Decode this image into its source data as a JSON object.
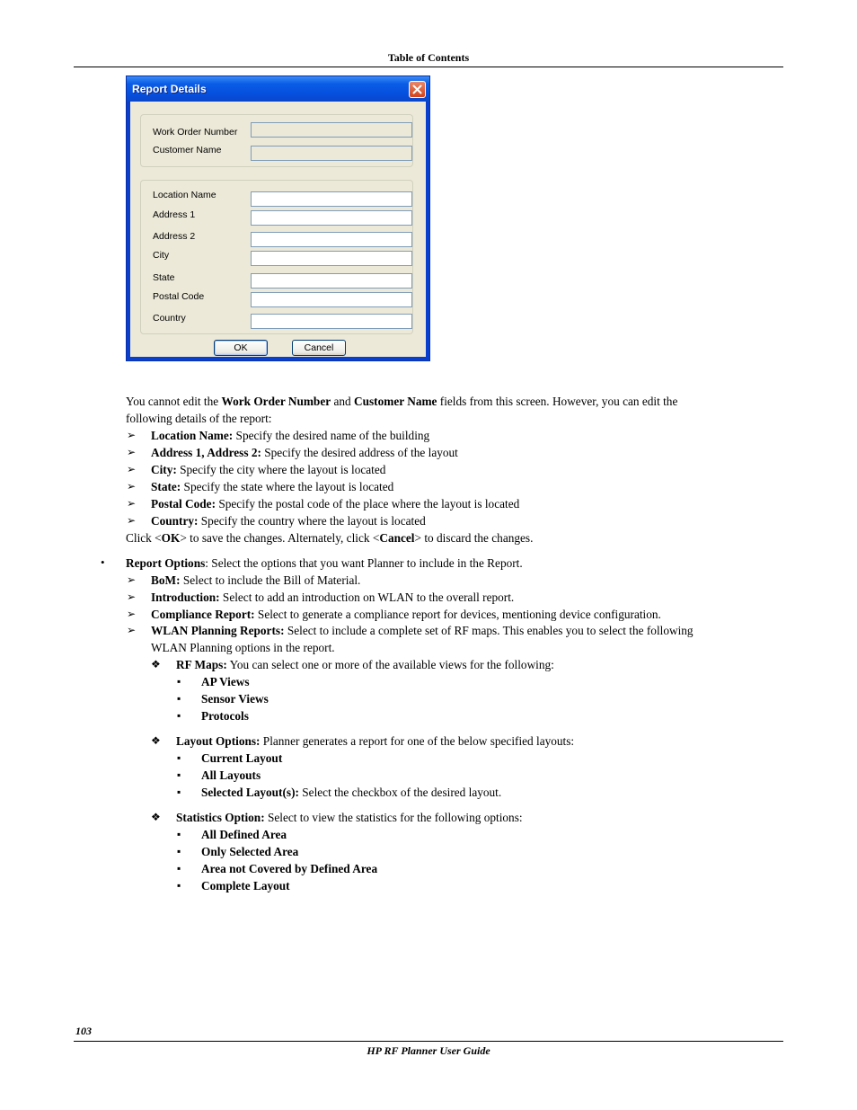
{
  "header": {
    "title": "Table of Contents"
  },
  "dialog": {
    "title": "Report Details",
    "close_icon": "close-icon",
    "group1": [
      {
        "label": "Work Order Number",
        "value": "",
        "readonly": true
      },
      {
        "label": "Customer Name",
        "value": "",
        "readonly": true
      }
    ],
    "group2": [
      {
        "label": "Location Name",
        "value": ""
      },
      {
        "label": "Address 1",
        "value": ""
      },
      {
        "label": "Address 2",
        "value": ""
      },
      {
        "label": "City",
        "value": ""
      },
      {
        "label": "State",
        "value": ""
      },
      {
        "label": "Postal Code",
        "value": ""
      },
      {
        "label": "Country",
        "value": ""
      }
    ],
    "ok_label": "OK",
    "cancel_label": "Cancel"
  },
  "body": {
    "intro": {
      "t1": "You cannot edit the ",
      "b1": "Work Order Number",
      "t2": " and ",
      "b2": "Customer Name",
      "t3": " fields from this screen. However, you can edit the",
      "line2": "following details of the report:"
    },
    "details": [
      {
        "term": "Location Name:",
        "desc": " Specify the desired name of the building"
      },
      {
        "term": "Address 1, Address 2:",
        "desc": " Specify the desired address of the layout"
      },
      {
        "term": "City:",
        "desc": " Specify the city where the layout is located"
      },
      {
        "term": "State:",
        "desc": " Specify the state where the layout is located"
      },
      {
        "term": "Postal Code:",
        "desc": " Specify the postal code of the place where the layout is located"
      },
      {
        "term": "Country:",
        "desc": " Specify the country where the layout is located"
      }
    ],
    "click_line": {
      "t1": "Click <",
      "b1": "OK",
      "t2": "> to save the changes. Alternately, click <",
      "b2": "Cancel",
      "t3": "> to discard the changes."
    },
    "report_options": {
      "term": "Report Options",
      "desc": ": Select the options that you want Planner to include in the Report.",
      "items": [
        {
          "term": "BoM:",
          "desc": " Select to include the Bill of Material."
        },
        {
          "term": "Introduction:",
          "desc": " Select to add an introduction on WLAN to the overall report."
        },
        {
          "term": "Compliance Report:",
          "desc": " Select to generate a compliance report for devices, mentioning device configuration."
        },
        {
          "term": "WLAN Planning Reports:",
          "desc": " Select to include a complete set of RF maps. This enables you to select the following",
          "desc2": "WLAN Planning options in the report."
        }
      ],
      "sub": [
        {
          "term": "RF Maps:",
          "desc": " You can select one or more of the available views for the following:",
          "items": [
            {
              "term": "AP Views",
              "desc": ""
            },
            {
              "term": "Sensor Views",
              "desc": ""
            },
            {
              "term": "Protocols",
              "desc": ""
            }
          ]
        },
        {
          "term": "Layout Options:",
          "desc": " Planner generates a report for one of the below specified layouts:",
          "items": [
            {
              "term": "Current Layout",
              "desc": ""
            },
            {
              "term": "All Layouts",
              "desc": ""
            },
            {
              "term": "Selected Layout(s):",
              "desc": " Select the checkbox of the desired layout."
            }
          ]
        },
        {
          "term": "Statistics Option:",
          "desc": " Select to view the statistics for the following options:",
          "items": [
            {
              "term": "All Defined Area",
              "desc": ""
            },
            {
              "term": "Only Selected Area",
              "desc": ""
            },
            {
              "term": "Area not Covered by Defined Area",
              "desc": ""
            },
            {
              "term": "Complete Layout",
              "desc": ""
            }
          ]
        }
      ]
    }
  },
  "footer": {
    "page_number": "103",
    "title": "HP RF Planner User Guide"
  }
}
